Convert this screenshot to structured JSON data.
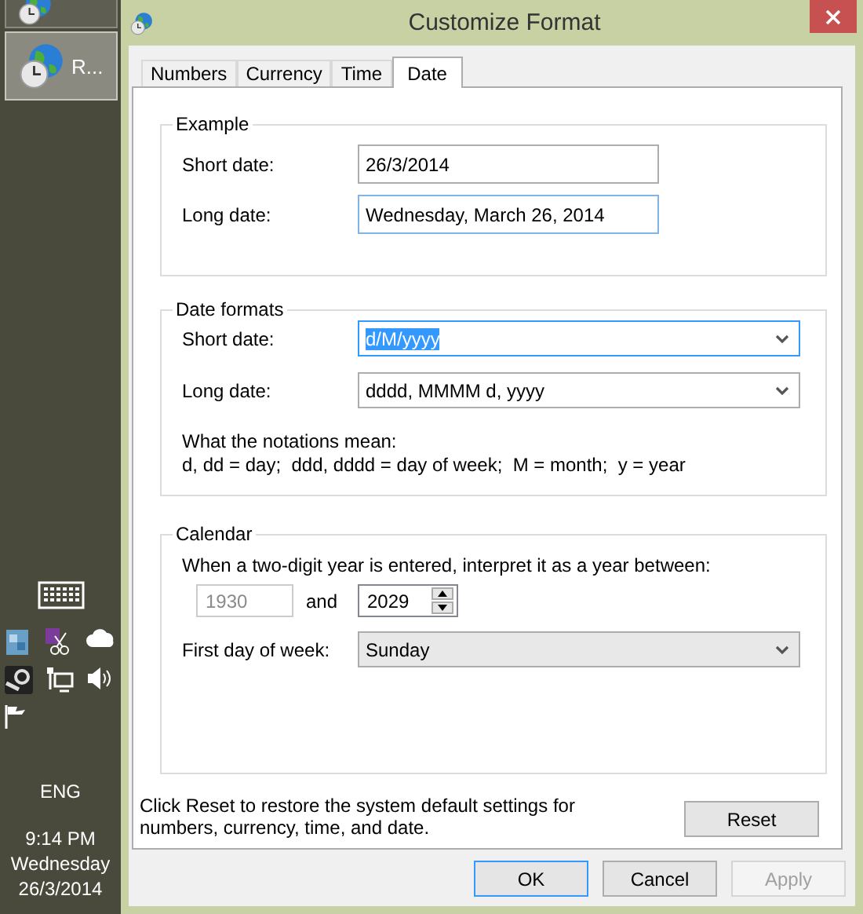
{
  "taskbar": {
    "buttons": [
      {
        "selected": false
      },
      {
        "label": "R...",
        "selected": true
      }
    ],
    "tray": {
      "language": "ENG",
      "time": "9:14 PM",
      "day": "Wednesday",
      "date": "26/3/2014"
    }
  },
  "dialog": {
    "title": "Customize Format",
    "tabs": [
      {
        "label": "Numbers",
        "selected": false
      },
      {
        "label": "Currency",
        "selected": false
      },
      {
        "label": "Time",
        "selected": false
      },
      {
        "label": "Date",
        "selected": true
      }
    ],
    "example": {
      "legend": "Example",
      "fields": [
        {
          "label": "Short date:",
          "value": "26/3/2014",
          "focused": false
        },
        {
          "label": "Long date:",
          "value": "Wednesday, March 26, 2014",
          "focused": true
        }
      ]
    },
    "date_formats": {
      "legend": "Date formats",
      "dropdowns": [
        {
          "label": "Short date:",
          "value": "d/M/yyyy",
          "focused": true,
          "highlighted": true
        },
        {
          "label": "Long date:",
          "value": "dddd, MMMM d, yyyy",
          "focused": false,
          "highlighted": false
        }
      ],
      "notation_title": "What the notations mean:",
      "notation_text": "d, dd = day;  ddd, dddd = day of week;  M = month;  y = year"
    },
    "calendar": {
      "legend": "Calendar",
      "sentence": "When a two-digit year is entered, interpret it as a year between:",
      "from_year": {
        "value": "1930",
        "disabled": true
      },
      "and": "and",
      "to_year": {
        "value": "2029",
        "disabled": false
      },
      "first_day": {
        "label": "First day of week:",
        "value": "Sunday"
      }
    },
    "reset_text": "Click Reset to restore the system default settings for numbers, currency, time, and date.",
    "reset_button": "Reset",
    "buttons": [
      {
        "label": "OK",
        "default": true,
        "disabled": false
      },
      {
        "label": "Cancel",
        "default": false,
        "disabled": false
      },
      {
        "label": "Apply",
        "default": false,
        "disabled": true
      }
    ]
  }
}
